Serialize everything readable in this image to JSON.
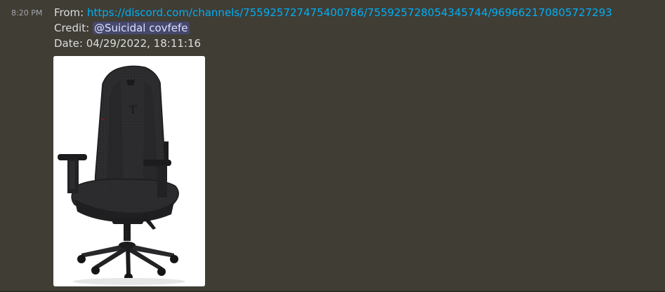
{
  "message": {
    "timestamp": "8:20 PM",
    "from_label": "From:",
    "from_link": "https://discord.com/channels/755925727475400786/755925728054345744/969662170805727293",
    "credit_label": "Credit:",
    "credit_mention": "@Suicidal covfefe",
    "date_label": "Date:",
    "date_value": "04/29/2022, 18:11:16"
  },
  "attachment": {
    "subject": "gaming chair",
    "colors": {
      "background": "#ffffff",
      "upholstery": "#2b2b2d",
      "frame": "#1c1c1e",
      "accent": "#8a1c24"
    }
  },
  "theme": {
    "background": "#403d35",
    "text": "#dcddde",
    "link": "#00aff4",
    "mention_bg": "#5865f24d"
  }
}
